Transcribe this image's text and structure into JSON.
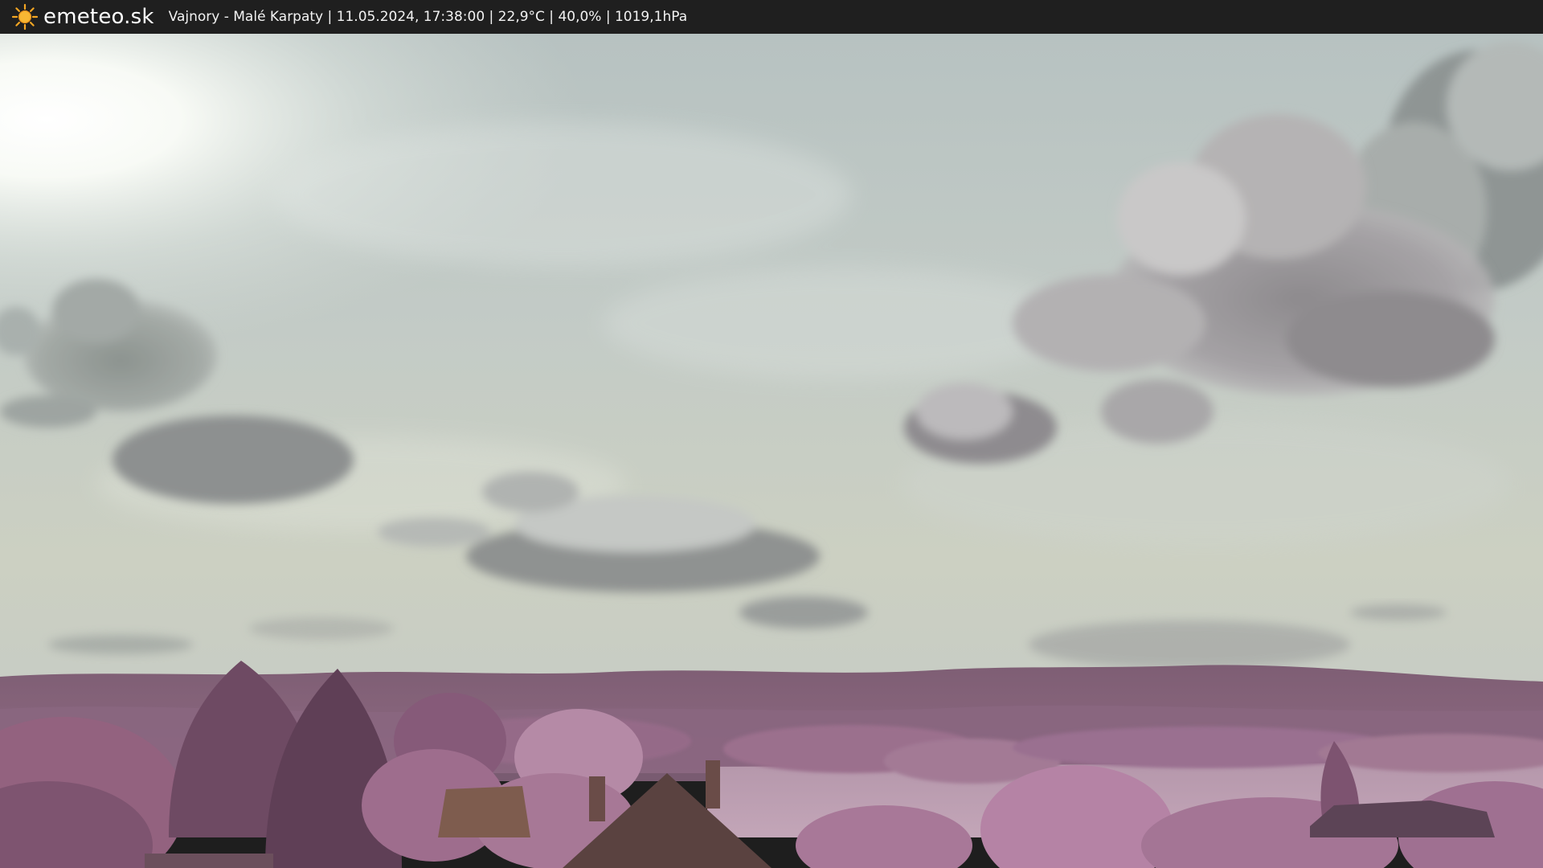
{
  "header": {
    "brand": "emeteo.sk",
    "logo_icon": "sun-icon",
    "camera_info": "Vajnory - Malé Karpaty | 11.05.2024, 17:38:00 | 22,9°C | 40,0% | 1019,1hPa"
  },
  "colors": {
    "topbar": "#1f1f1f",
    "sun": "#f5a623",
    "sky_top": "#b9c4c3",
    "sky_horizon": "#c9cdc0",
    "foliage": "#9e6b8c",
    "hills": "#7d5b72"
  }
}
